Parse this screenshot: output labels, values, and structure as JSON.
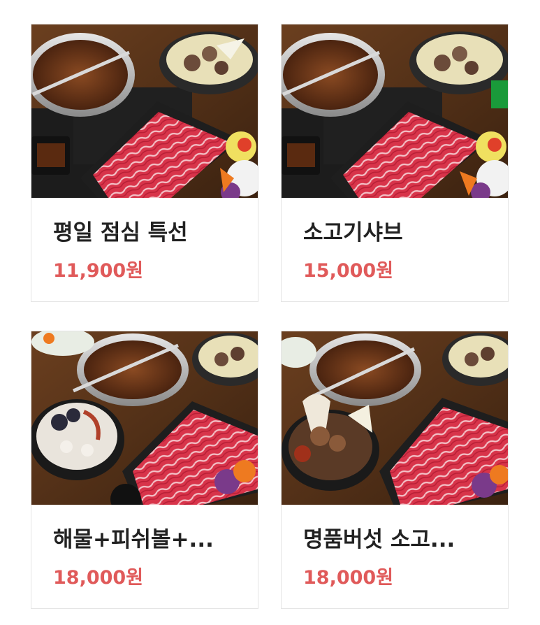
{
  "menu_items": [
    {
      "name": "평일 점심 특선",
      "price": "11,900원",
      "image": "beef-shabu-hotpot-photo"
    },
    {
      "name": "소고기샤브",
      "price": "15,000원",
      "image": "beef-shabu-hotpot-photo"
    },
    {
      "name": "해물+피쉬볼+...",
      "price": "18,000원",
      "image": "seafood-shabu-hotpot-photo"
    },
    {
      "name": "명품버섯 소고...",
      "price": "18,000원",
      "image": "mushroom-shabu-hotpot-photo"
    }
  ],
  "colors": {
    "price": "#e05a5a",
    "name": "#222222",
    "border": "#e4e4e4"
  }
}
